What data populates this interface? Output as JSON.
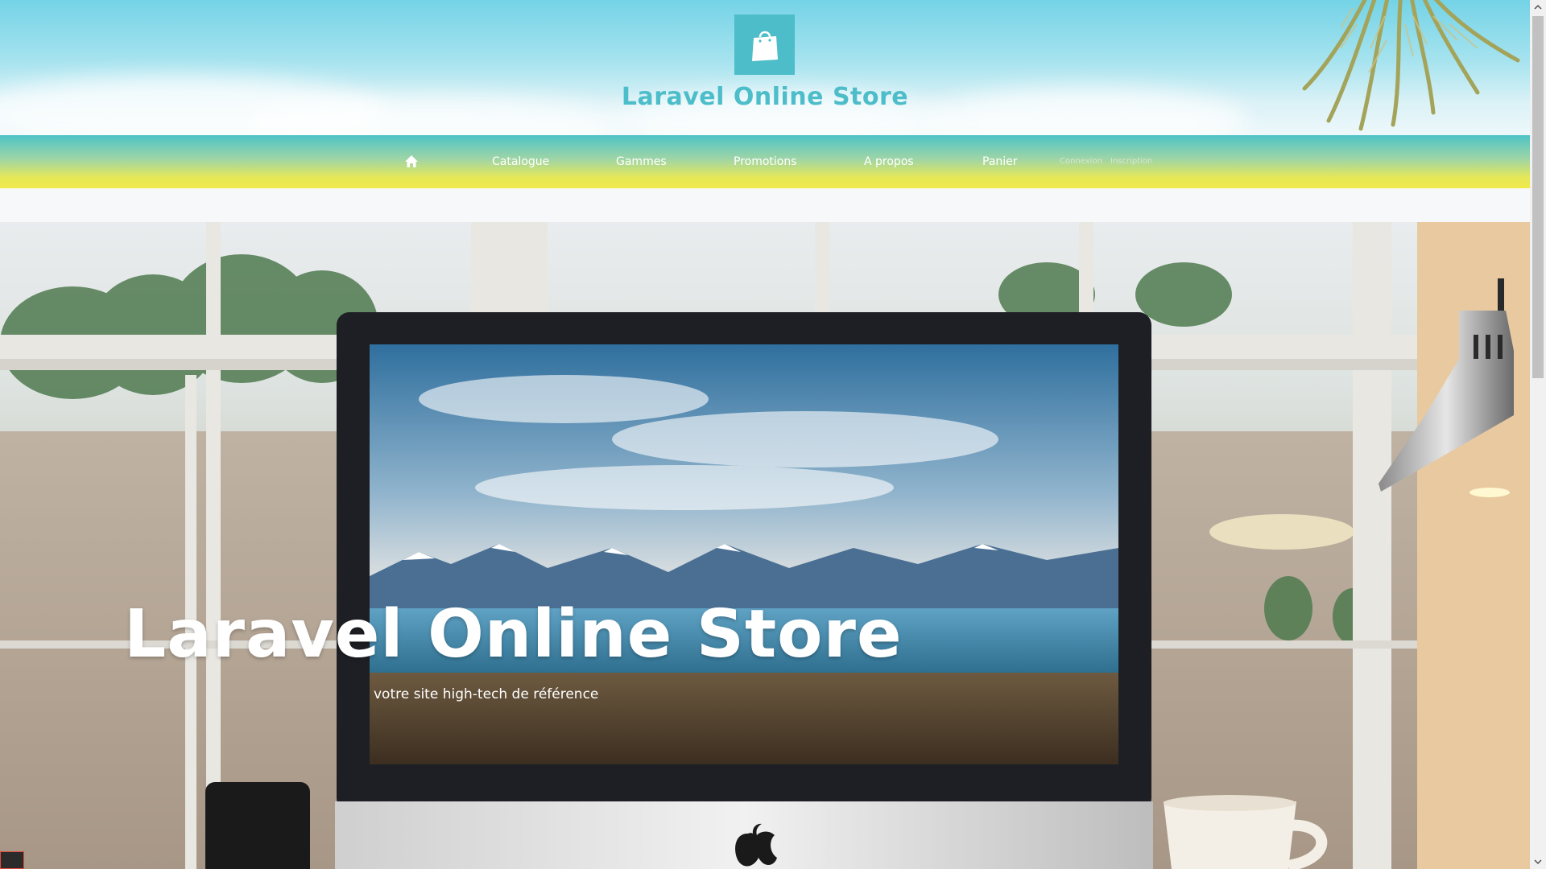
{
  "header": {
    "brand": "Laravel Online Store",
    "logo_icon": "shopping-bag-icon",
    "logo_color": "#4dbdc9"
  },
  "nav": {
    "home_icon": "home-icon",
    "items": [
      {
        "label": "Catalogue"
      },
      {
        "label": "Gammes"
      },
      {
        "label": "Promotions"
      },
      {
        "label": "A propos"
      },
      {
        "label": "Panier"
      }
    ],
    "auth": {
      "login": "Connexion",
      "register": "Inscription"
    }
  },
  "hero": {
    "title": "Laravel Online Store",
    "subtitle": "votre site high-tech de référence"
  },
  "scrollbar": {
    "up_icon": "chevron-up-icon",
    "down_icon": "chevron-down-icon"
  }
}
